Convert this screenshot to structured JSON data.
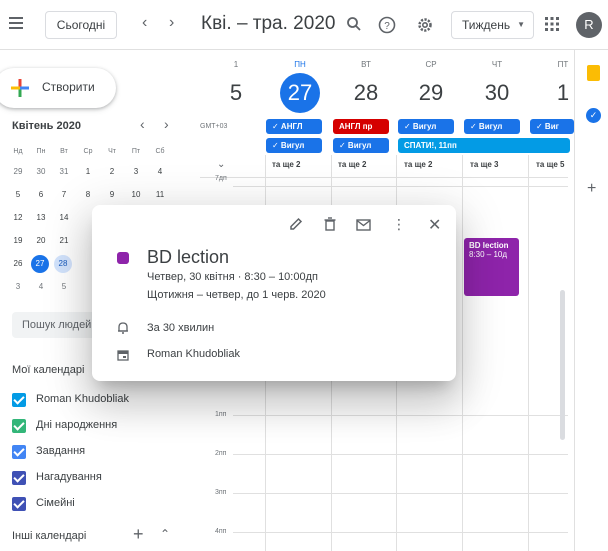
{
  "header": {
    "menu_icon": "menu-icon",
    "today_label": "Сьогодні",
    "title": "Кві. – тра. 2020",
    "view_label": "Тиждень",
    "avatar_letter": "R"
  },
  "sidebar": {
    "create_label": "Створити",
    "mini_month_title": "Квітень 2020",
    "dow": [
      "Нд",
      "Пн",
      "Вт",
      "Ср",
      "Чт",
      "Пт",
      "Сб"
    ],
    "weeks": [
      [
        "29",
        "30",
        "31",
        "1",
        "2",
        "3",
        "4"
      ],
      [
        "5",
        "6",
        "7",
        "8",
        "9",
        "10",
        "11"
      ],
      [
        "12",
        "13",
        "14",
        "",
        "",
        "",
        ""
      ],
      [
        "19",
        "20",
        "21",
        "",
        "",
        "",
        ""
      ],
      [
        "26",
        "27",
        "28",
        "",
        "",
        "",
        ""
      ],
      [
        "3",
        "4",
        "5",
        "",
        "",
        "",
        ""
      ]
    ],
    "search_people_placeholder": "Пошук людей",
    "my_calendars_title": "Мої календарі",
    "my_calendars": [
      {
        "label": "Roman Khudobliak",
        "color": "#039be5"
      },
      {
        "label": "Дні народження",
        "color": "#33b679"
      },
      {
        "label": "Завдання",
        "color": "#4285f4"
      },
      {
        "label": "Нагадування",
        "color": "#3f51b5"
      },
      {
        "label": "Сімейні",
        "color": "#3f51b5"
      }
    ],
    "other_calendars_title": "Інші календарі"
  },
  "grid": {
    "timezone": "GMT+03",
    "days": [
      {
        "dow": "",
        "num": "5"
      },
      {
        "dow": "ПН",
        "num": "27",
        "today": true
      },
      {
        "dow": "ВТ",
        "num": "28"
      },
      {
        "dow": "СР",
        "num": "29"
      },
      {
        "dow": "ЧТ",
        "num": "30"
      },
      {
        "dow": "ПТ",
        "num": "1"
      }
    ],
    "partial_dow": "1",
    "hours": [
      "7дп",
      "1пп",
      "2пп",
      "3пп",
      "4пп"
    ],
    "allday_row1": [
      {
        "label": "✓ АНГЛ",
        "color": "#1a73e8"
      },
      {
        "label": "АНГЛ пр",
        "color": "#d50000"
      },
      {
        "label": "✓ Вигул",
        "color": "#1a73e8"
      },
      {
        "label": "✓ Вигул",
        "color": "#1a73e8"
      },
      {
        "label": "✓ Виг",
        "color": "#1a73e8"
      }
    ],
    "allday_row2": [
      {
        "label": "✓ Вигул",
        "color": "#1a73e8"
      },
      {
        "label": "✓ Вигул",
        "color": "#1a73e8"
      },
      {
        "label": "СПАТИ!, 11пп",
        "color": "#039be5"
      }
    ],
    "more_labels": [
      "та ще 2",
      "та ще 2",
      "та ще 2",
      "та ще 3",
      "та ще 5"
    ],
    "event": {
      "title": "BD lection",
      "time": "8:30 – 10д",
      "color": "#8e24aa"
    }
  },
  "popup": {
    "title": "BD lection",
    "color": "#8e24aa",
    "date_line": "Четвер, 30 квітня  ·  8:30 – 10:00дп",
    "recurrence": "Щотижня – четвер, до 1 черв. 2020",
    "reminder": "За 30 хвилин",
    "calendar_owner": "Roman Khudobliak"
  }
}
